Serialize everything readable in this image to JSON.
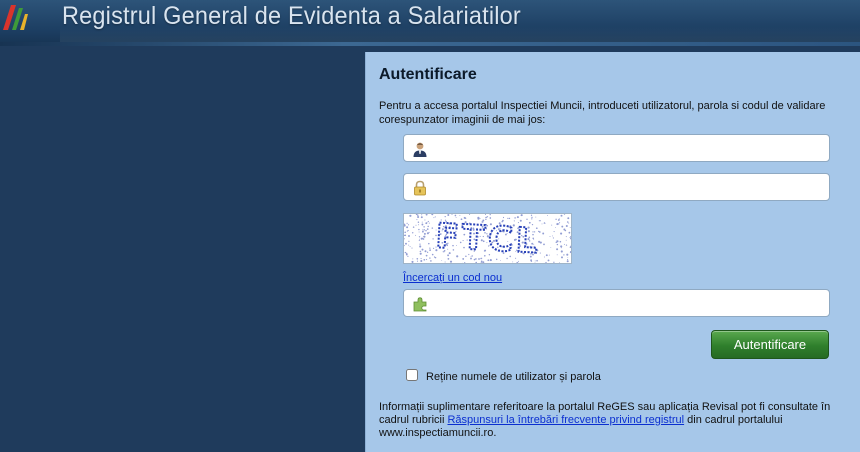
{
  "header": {
    "title": "Registrul General de Evidenta a Salariatilor",
    "logo_icon": "reges-logo-icon"
  },
  "login": {
    "title": "Autentificare",
    "intro": "Pentru a accesa portalul Inspectiei Muncii, introduceti utilizatorul, parola si codul de validare corespunzator imaginii de mai jos:",
    "username": {
      "value": "",
      "placeholder": "",
      "icon": "user-icon"
    },
    "password": {
      "value": "",
      "placeholder": "",
      "icon": "lock-icon"
    },
    "captcha_text": "FTCL",
    "refresh_link": "Încercați un cod nou",
    "code": {
      "value": "",
      "placeholder": "",
      "icon": "puzzle-icon"
    },
    "submit_label": "Autentificare",
    "remember_label": "Reține numele de utilizator și parola",
    "remember_checked": false
  },
  "info": {
    "text_before": "Informații suplimentare referitoare la portalul ReGES sau aplicația Revisal pot fi consultate în cadrul rubricii",
    "link": "Răspunsuri la întrebări frecvente privind registrul",
    "text_after": "din cadrul portalului www.inspectiamuncii.ro."
  },
  "colors": {
    "header_bg": "#1d3f63",
    "sidebar_bg": "#1f3b5c",
    "panel_bg": "#a6c7e9",
    "button_green": "#2f7f2c",
    "link_blue": "#0b2fd0"
  }
}
